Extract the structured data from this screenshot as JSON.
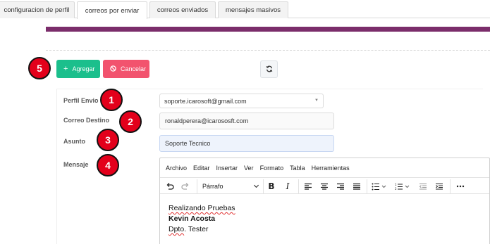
{
  "tabs": [
    {
      "label": "configuracion de perfil"
    },
    {
      "label": "correos por enviar"
    },
    {
      "label": "correos enviados"
    },
    {
      "label": "mensajes masivos"
    }
  ],
  "toolbar": {
    "agregar_label": "Agregar",
    "cancelar_label": "Cancelar",
    "colors": {
      "agregar": "#1bbf8c",
      "cancelar": "#f2536e",
      "header_bar": "#7b2d6b",
      "badge": "#e3001b"
    }
  },
  "form": {
    "perfil_label": "Perfil Envio",
    "perfil_value": "soporte.icarosoft@gmail.com",
    "correo_label": "Correo Destino",
    "correo_value": "ronaldperera@icarososft.com",
    "asunto_label": "Asunto",
    "asunto_value": "Soporte Tecnico",
    "mensaje_label": "Mensaje"
  },
  "badges": [
    "1",
    "2",
    "3",
    "4",
    "5"
  ],
  "editor": {
    "menu": [
      "Archivo",
      "Editar",
      "Insertar",
      "Ver",
      "Formato",
      "Tabla",
      "Herramientas"
    ],
    "block_format": "Párrafo",
    "icons": [
      "undo-icon",
      "redo-icon",
      "bold-icon",
      "italic-icon",
      "align-left-icon",
      "align-center-icon",
      "align-right-icon",
      "justify-icon",
      "bullet-list-icon",
      "numbered-list-icon",
      "outdent-icon",
      "indent-icon",
      "more-icon"
    ],
    "content": {
      "line1": "Realizando Pruebas",
      "line2": "Kevin Acosta",
      "line3_prefix": "Dpto",
      "line3_rest": ". Tester"
    }
  }
}
